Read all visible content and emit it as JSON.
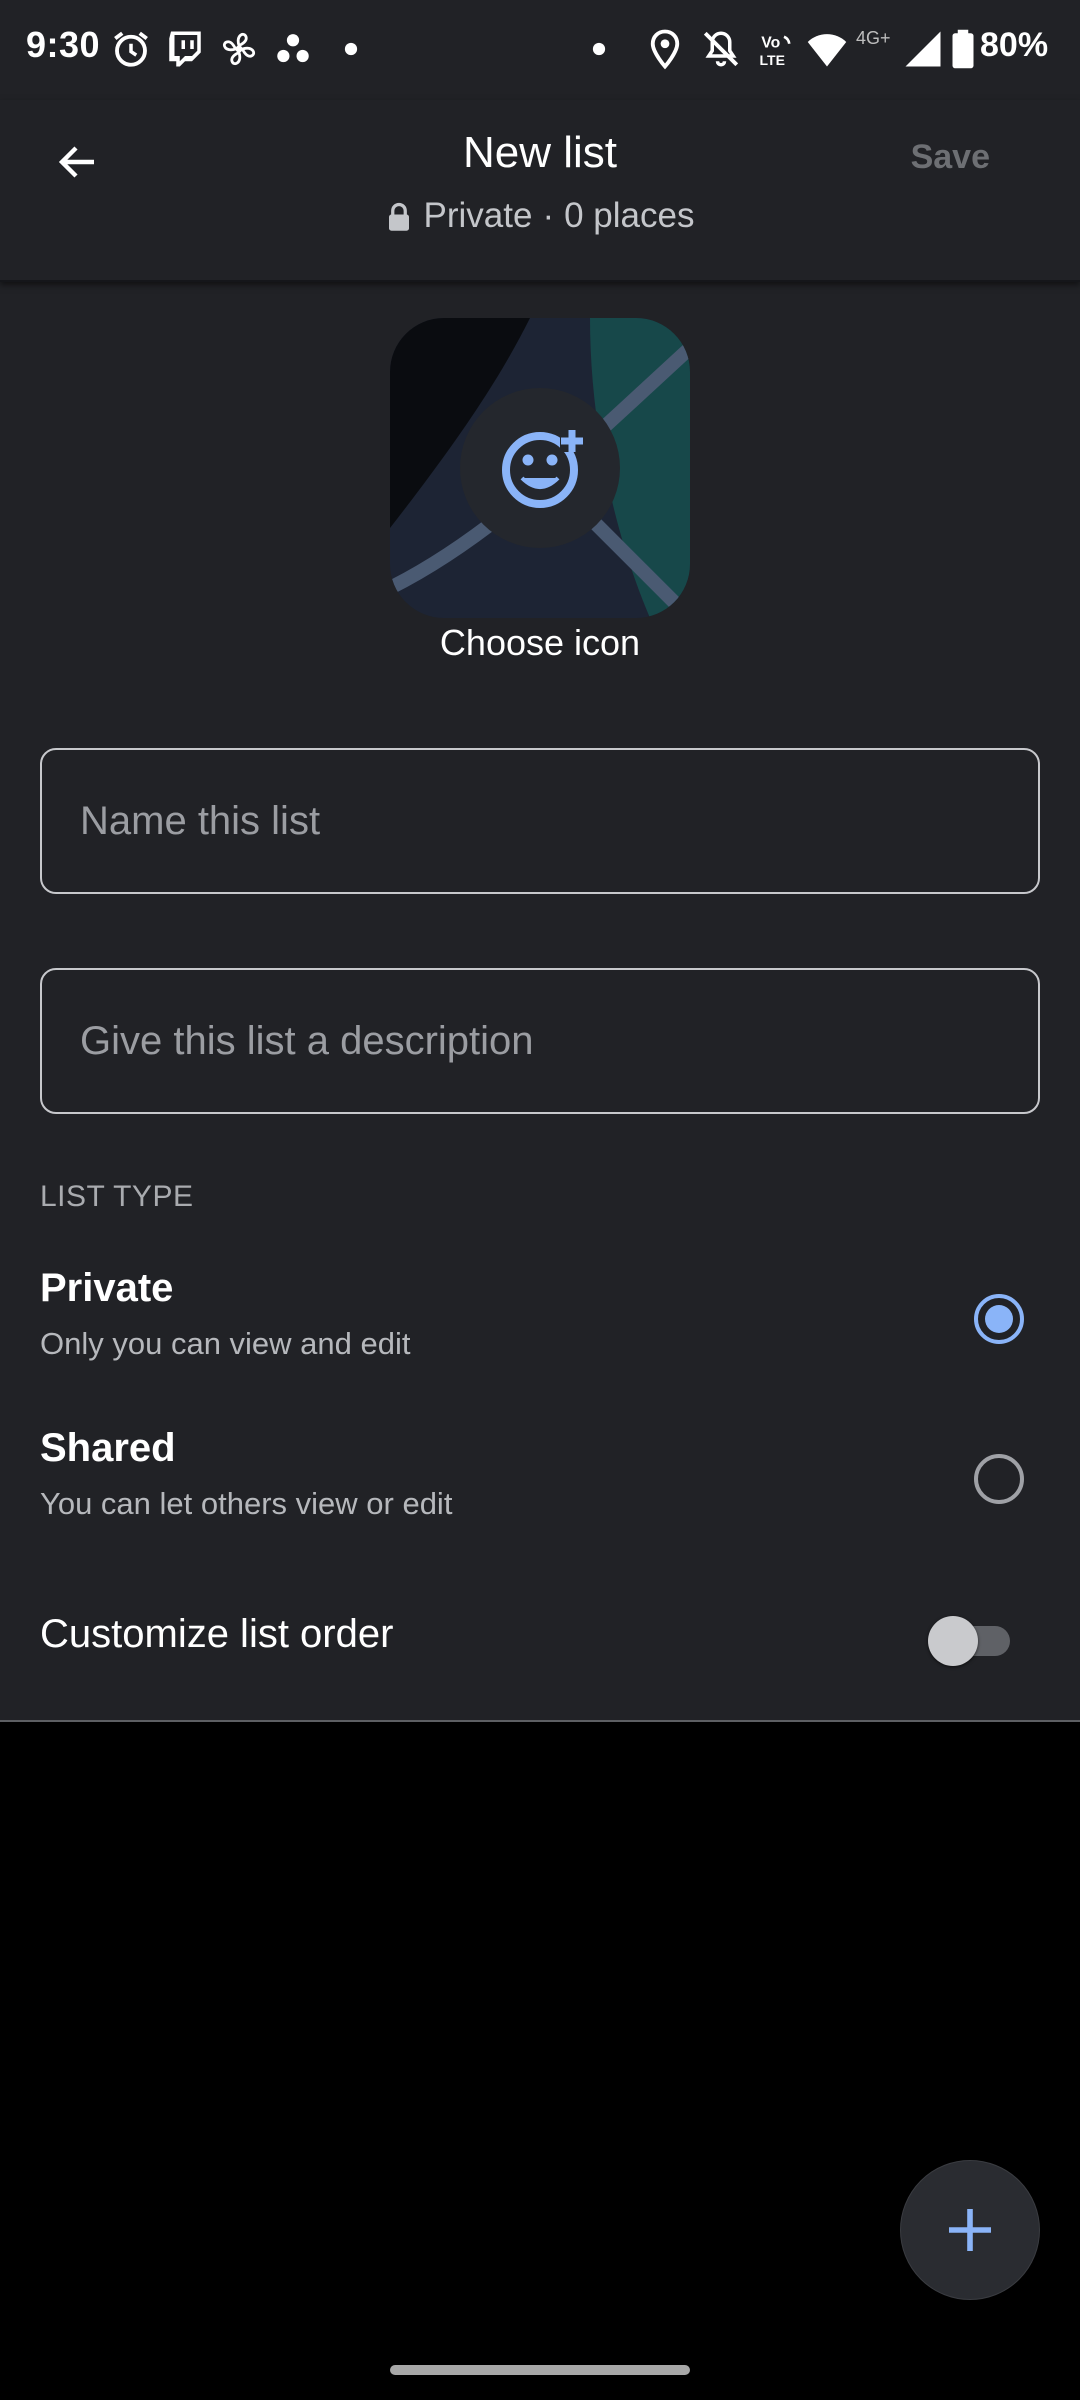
{
  "status_bar": {
    "time": "9:30",
    "network": "4G+",
    "battery": "80%",
    "icons": [
      "alarm-icon",
      "twitch-icon",
      "fan-icon",
      "dots-icon",
      "notification-dot-icon",
      "location-icon",
      "bell-off-icon",
      "volte-icon",
      "wifi-icon",
      "signal-icon",
      "battery-icon"
    ]
  },
  "header": {
    "title": "New list",
    "privacy": "Private",
    "separator": "·",
    "places": "0 places",
    "save_label": "Save"
  },
  "icon_chooser": {
    "label": "Choose icon",
    "icon": "add-emoji-icon"
  },
  "form": {
    "name_placeholder": "Name this list",
    "name_value": "",
    "description_placeholder": "Give this list a description",
    "description_value": ""
  },
  "list_type": {
    "section_label": "LIST TYPE",
    "options": [
      {
        "title": "Private",
        "description": "Only you can view and edit",
        "selected": true
      },
      {
        "title": "Shared",
        "description": "You can let others view or edit",
        "selected": false
      }
    ]
  },
  "customize": {
    "label": "Customize list order",
    "enabled": false
  },
  "fab": {
    "icon": "plus-icon"
  },
  "colors": {
    "background": "#212226",
    "accent": "#8ab4f8",
    "text": "#ffffff",
    "muted_text": "#b6b8bc",
    "disabled_text": "#6d6f73"
  }
}
